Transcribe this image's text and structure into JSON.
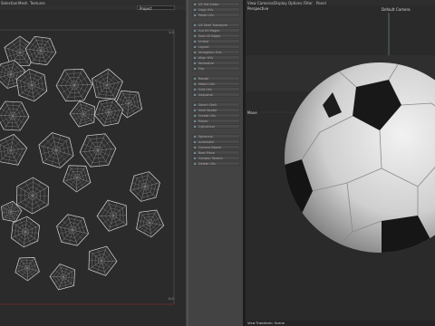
{
  "menubar": {
    "items": [
      "Selection",
      "Mesh",
      "Textures",
      "View",
      "Cameras",
      "Display",
      "Options",
      "Filter",
      "Panel"
    ]
  },
  "uv_editor": {
    "projection_value": "Project",
    "corner_top": "1.0",
    "corner_bottom": "0.0"
  },
  "tools": [
    "UV Set Editor",
    "Copy UVs",
    "Paste UVs",
    "UV Shell Transform",
    "Cut UV Edges",
    "Sew UV Edges",
    "Unfold",
    "Layout",
    "Straighten UVs",
    "Align UVs",
    "Normalize",
    "Flip",
    "Rotate",
    "Match UVs",
    "Grid UVs",
    "Snapshot",
    "Select Shell",
    "Shell Border",
    "Create UVs",
    "Planar",
    "Cylindrical",
    "Spherical",
    "Automatic",
    "Camera Based",
    "Best Plane",
    "Contour Stretch",
    "Delete UVs"
  ],
  "viewport": {
    "title": "Perspective",
    "camera": "Default Camera",
    "axis_label": "Move",
    "status": "View Transform: Scene"
  },
  "colors": {
    "uv_wire": "#9a9a9a",
    "ball_white": "#dcdcdc",
    "ball_black": "#161616",
    "uv_bound": "#7a2a2a"
  }
}
